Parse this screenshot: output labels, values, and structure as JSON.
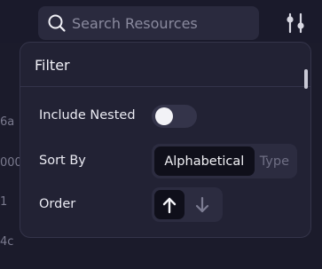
{
  "search": {
    "placeholder": "Search Resources",
    "value": ""
  },
  "toolbar": {
    "filter_icon": "sliders-icon"
  },
  "background_ids": [
    "6a",
    "000",
    "1",
    "4c"
  ],
  "filter": {
    "title": "Filter",
    "include_nested": {
      "label": "Include Nested",
      "enabled": false
    },
    "sort_by": {
      "label": "Sort By",
      "options": [
        "Alphabetical",
        "Type"
      ],
      "selected": "Alphabetical"
    },
    "order": {
      "label": "Order",
      "options": [
        "ascending",
        "descending"
      ],
      "selected": "ascending"
    }
  },
  "colors": {
    "background": "#1a1a2b",
    "panel": "#222234",
    "control": "#2c2c40",
    "active": "#0f0f1a"
  }
}
